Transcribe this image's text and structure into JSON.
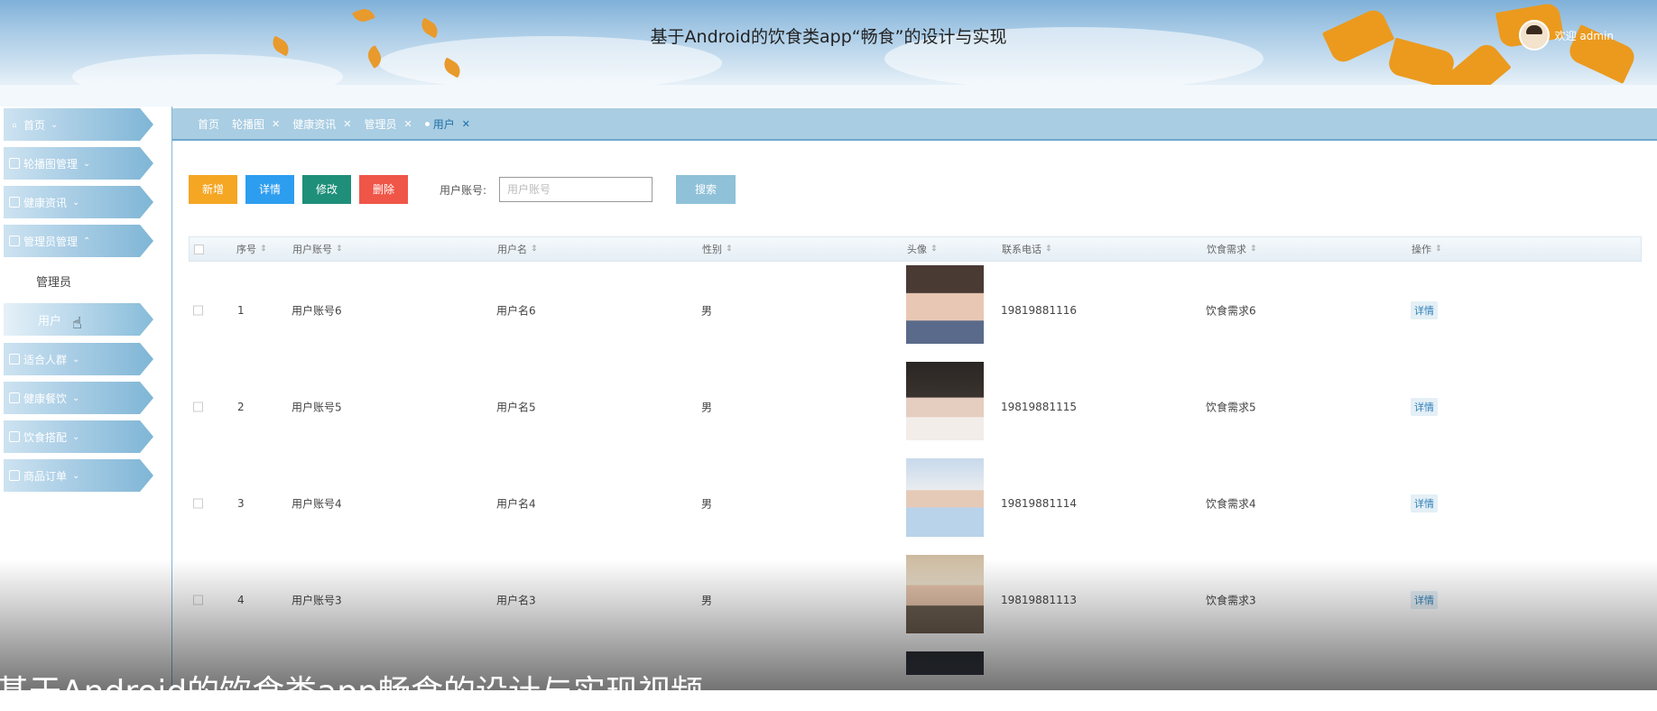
{
  "header": {
    "title": "基于Android的饮食类app“畅食”的设计与实现",
    "welcome": "欢迎 admin"
  },
  "sidebar": {
    "items": [
      {
        "label": "首页",
        "icon": "home-icon",
        "chevron": "⌄"
      },
      {
        "label": "轮播图管理",
        "icon": "grid-icon",
        "chevron": "⌄"
      },
      {
        "label": "健康资讯",
        "icon": "grid-icon",
        "chevron": "⌄"
      },
      {
        "label": "管理员管理",
        "icon": "folder-icon",
        "chevron": "⌃"
      },
      {
        "label": "适合人群",
        "icon": "list-icon",
        "chevron": "⌄"
      },
      {
        "label": "健康餐饮",
        "icon": "list-icon",
        "chevron": "⌄"
      },
      {
        "label": "饮食搭配",
        "icon": "grid-icon",
        "chevron": "⌄"
      },
      {
        "label": "商品订单",
        "icon": "shop-icon",
        "chevron": "⌄"
      }
    ],
    "sub_items": [
      "管理员",
      "用户"
    ]
  },
  "tabs": [
    {
      "label": "首页",
      "closable": false
    },
    {
      "label": "轮播图",
      "closable": true
    },
    {
      "label": "健康资讯",
      "closable": true
    },
    {
      "label": "管理员",
      "closable": true
    },
    {
      "label": "用户",
      "closable": true,
      "active": true
    }
  ],
  "toolbar": {
    "add": "新增",
    "detail": "详情",
    "edit": "修改",
    "delete": "删除",
    "search_label": "用户账号:",
    "search_placeholder": "用户账号",
    "search_value": "",
    "search_button": "搜索"
  },
  "table": {
    "columns": [
      "序号",
      "用户账号",
      "用户名",
      "性别",
      "头像",
      "联系电话",
      "饮食需求",
      "操作"
    ],
    "rows": [
      {
        "index": "1",
        "account": "用户账号6",
        "name": "用户名6",
        "gender": "男",
        "phone": "19819881116",
        "need": "饮食需求6",
        "action": "详情"
      },
      {
        "index": "2",
        "account": "用户账号5",
        "name": "用户名5",
        "gender": "男",
        "phone": "19819881115",
        "need": "饮食需求5",
        "action": "详情"
      },
      {
        "index": "3",
        "account": "用户账号4",
        "name": "用户名4",
        "gender": "男",
        "phone": "19819881114",
        "need": "饮食需求4",
        "action": "详情"
      },
      {
        "index": "4",
        "account": "用户账号3",
        "name": "用户名3",
        "gender": "男",
        "phone": "19819881113",
        "need": "饮食需求3",
        "action": "详情"
      }
    ]
  },
  "overlay_caption": "基于Android的饮食类app畅食的设计与实现视频",
  "colors": {
    "btn_add": "#f5a623",
    "btn_detail": "#2d9df0",
    "btn_edit": "#1f8f7a",
    "btn_delete": "#ef5648",
    "btn_search": "#8fc1d8",
    "accent": "#7fb6d6"
  }
}
